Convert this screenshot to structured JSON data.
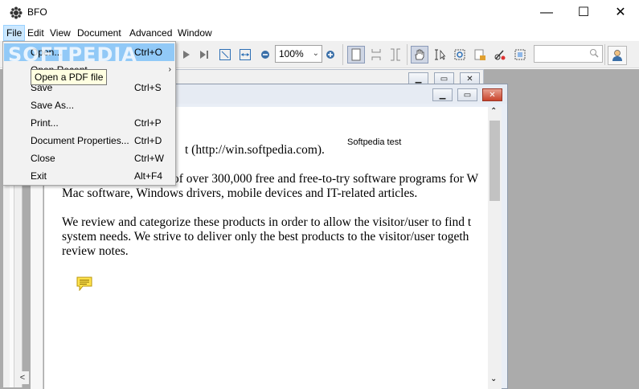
{
  "window": {
    "title": "BFO",
    "minimize": "—",
    "maximize": "☐",
    "close": "✕"
  },
  "menubar": [
    "File",
    "Edit",
    "View",
    "Document",
    "Advanced",
    "Window"
  ],
  "toolbar": {
    "zoom": "100%",
    "search_placeholder": "",
    "icons": [
      "play-icon",
      "last-page-icon",
      "fit-page-icon",
      "fit-width-icon",
      "zoom-out-icon",
      "zoom-in-icon",
      "single-page-icon",
      "continuous-page-icon",
      "facing-pages-icon",
      "hand-tool-icon",
      "text-select-icon",
      "marquee-zoom-icon",
      "snapshot-icon",
      "annotation-icon",
      "select-area-icon",
      "search-icon",
      "user-icon"
    ]
  },
  "file_menu": {
    "items": [
      {
        "label": "Open...",
        "shortcut": "Ctrl+O"
      },
      {
        "label": "Open Recent",
        "shortcut": "",
        "submenu": true
      },
      {
        "label": "Save",
        "shortcut": "Ctrl+S"
      },
      {
        "label": "Save As...",
        "shortcut": ""
      },
      {
        "label": "Print...",
        "shortcut": "Ctrl+P"
      },
      {
        "label": "Document Properties...",
        "shortcut": "Ctrl+D"
      },
      {
        "label": "Close",
        "shortcut": "Ctrl+W"
      },
      {
        "label": "Exit",
        "shortcut": "Alt+F4"
      }
    ],
    "tooltip": "Open a PDF file",
    "submenu_arrow": "›"
  },
  "watermark": "SOFTPEDIA",
  "document": {
    "label": "Softpedia test",
    "line1": "t (http://win.softpedia.com).",
    "line2": "of over 300,000 free and free-to-try software programs for W",
    "line3": "Mac software, Windows drivers, mobile devices and IT-related articles.",
    "line4": "We review and categorize these products in order to allow the visitor/user to find t",
    "line5": "system needs. We strive to deliver only the best products to the visitor/user togeth",
    "line6": "review notes."
  },
  "colors": {
    "menu_hover": "#91c9f7",
    "tooltip_bg": "#ffffe1",
    "note_yellow": "#ffe34d"
  }
}
